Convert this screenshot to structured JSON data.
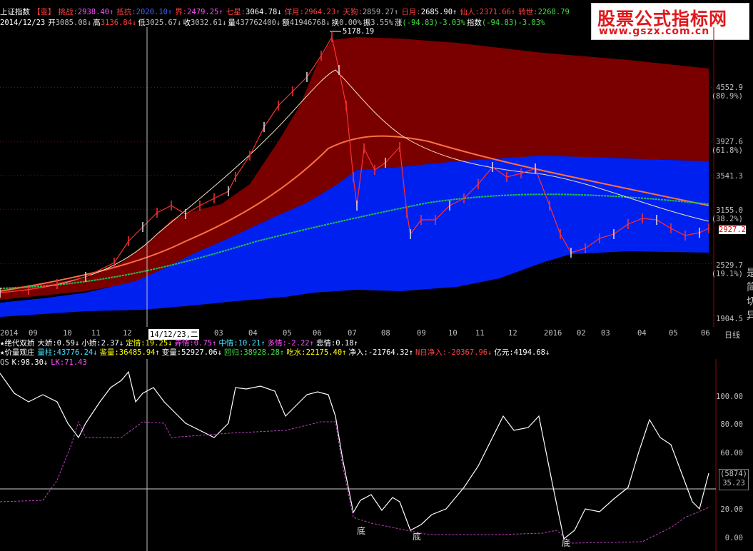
{
  "header_row1": {
    "index_name": "上证指数",
    "mode": "【变】",
    "items": [
      {
        "label": "挑战",
        "value": "2938.40",
        "arrow": "↑",
        "color": "#ff50ff"
      },
      {
        "label": "抵抗",
        "value": "2020.10",
        "arrow": "↑",
        "color": "#4060ff"
      },
      {
        "label": "界",
        "value": "2479.25",
        "arrow": "↑",
        "color": "#ff50ff"
      },
      {
        "label": "七星",
        "value": "3064.78",
        "arrow": "↓",
        "color": "#ffffff"
      },
      {
        "label": "佯月",
        "value": "2964.23",
        "arrow": "↑",
        "color": "#ff4040"
      },
      {
        "label": "天狗",
        "value": "2859.27",
        "arrow": "↑",
        "color": "#b0b0b0"
      },
      {
        "label": "日月",
        "value": "2685.90",
        "arrow": "↑",
        "color": "#ffffff"
      },
      {
        "label": "仙人",
        "value": "2371.66",
        "arrow": "↑",
        "color": "#ff4040"
      },
      {
        "label": "转世",
        "value": "2268.79",
        "arrow": "",
        "color": "#40e040"
      }
    ]
  },
  "header_row2": {
    "date": "2014/12/23",
    "items": [
      {
        "label": "开",
        "value": "3085.08",
        "arrow": "↓",
        "color": "#c0c0c0"
      },
      {
        "label": "高",
        "value": "3136.84",
        "arrow": "↓",
        "color": "#ff4040"
      },
      {
        "label": "低",
        "value": "3025.67",
        "arrow": "↓",
        "color": "#c0c0c0"
      },
      {
        "label": "收",
        "value": "3032.61",
        "arrow": "↓",
        "color": "#c0c0c0"
      },
      {
        "label": "量",
        "value": "437762400",
        "arrow": "↓",
        "color": "#c0c0c0"
      },
      {
        "label": "额",
        "value": "41946768",
        "arrow": "↓",
        "color": "#c0c0c0"
      },
      {
        "label": "换",
        "value": "0.00%",
        "arrow": "",
        "color": "#c0c0c0"
      },
      {
        "label": "振",
        "value": "3.55%",
        "arrow": "",
        "color": "#c0c0c0"
      },
      {
        "label": "涨",
        "value": "(-94.83)-3.03%",
        "arrow": "",
        "color": "#40e040"
      },
      {
        "label": "指数",
        "value": "(-94.83)-3.03%",
        "arrow": "",
        "color": "#40e040"
      }
    ]
  },
  "brand": {
    "title": "股票公式指标网",
    "url": "www.gszx.com.cn"
  },
  "main_chart": {
    "high_annotation": "5178.19",
    "current_price": "2927.2",
    "y_ticks": [
      {
        "label": "4552.9",
        "pct": "(80.9%)"
      },
      {
        "label": "3927.6",
        "pct": "(61.8%)"
      },
      {
        "label": "3541.3",
        "pct": ""
      },
      {
        "label": "3155.0",
        "pct": "(38.2%)"
      },
      {
        "label": "2529.7",
        "pct": "(19.1%)"
      },
      {
        "label": "1904.5",
        "pct": ""
      }
    ]
  },
  "x_axis": {
    "labels": [
      "2014",
      "09",
      "10",
      "11",
      "12",
      "14/12/23,二",
      "03",
      "04",
      "05",
      "06",
      "07",
      "08",
      "09",
      "10",
      "11",
      "12",
      "2016",
      "02",
      "03",
      "04",
      "05",
      "06"
    ],
    "right_label": "日线"
  },
  "indicator_row1": {
    "title": "★绝代双娇",
    "items": [
      {
        "label": "大娇",
        "value": "0.59",
        "arrow": "↓",
        "color": "#ffffff"
      },
      {
        "label": "小娇",
        "value": "2.37",
        "arrow": "↓",
        "color": "#ffffff"
      },
      {
        "label": "定情",
        "value": "19.25",
        "arrow": "↓",
        "color": "#ffff00"
      },
      {
        "label": "弄情",
        "value": "0.75",
        "arrow": "↑",
        "color": "#ff50ff"
      },
      {
        "label": "中情",
        "value": "10.21",
        "arrow": "↑",
        "color": "#40e0ff"
      },
      {
        "label": "多情",
        "value": "-2.22",
        "arrow": "↑",
        "color": "#ff50ff"
      },
      {
        "label": "悲情",
        "value": "0.18",
        "arrow": "↑",
        "color": "#ffffff"
      }
    ]
  },
  "indicator_row2": {
    "title": "★价量观庄",
    "items": [
      {
        "label": "量柱",
        "value": "43776.24",
        "arrow": "↓",
        "color": "#40e0ff"
      },
      {
        "label": "鉴量",
        "value": "36485.94",
        "arrow": "↑",
        "color": "#ffff00"
      },
      {
        "label": "变量",
        "value": "52927.06",
        "arrow": "↓",
        "color": "#ffffff"
      },
      {
        "label": "回归",
        "value": "38928.28",
        "arrow": "↑",
        "color": "#40e040"
      },
      {
        "label": "吃水",
        "value": "22175.40",
        "arrow": "↑",
        "color": "#ffff00"
      },
      {
        "label": "净入",
        "value": "-21764.32",
        "arrow": "↑",
        "color": "#ffffff"
      },
      {
        "label": "N日净入",
        "value": "-20367.96",
        "arrow": "↓",
        "color": "#ff4040"
      },
      {
        "label": "亿元",
        "value": "4194.68",
        "arrow": "↓",
        "color": "#ffffff"
      }
    ]
  },
  "oscillator": {
    "name": "QS",
    "k_label": "K:98.30",
    "k_arrow": "↓",
    "lk_label": "LK:71.43",
    "y_ticks": [
      "100.00",
      "80.00",
      "60.00",
      "20.00",
      "0.00"
    ],
    "box_top": "(5874)",
    "box_bottom": "35.23",
    "bottom_markers": [
      "底",
      "底",
      "底"
    ]
  },
  "right_edge_glyphs": [
    "是",
    "简",
    "切",
    "异"
  ],
  "colors": {
    "upper_band": "#7a0000",
    "lower_band": "#0020f0",
    "price_up": "#ff3030",
    "price_down": "#e0e0e0",
    "ma_orange": "#ff7040",
    "ma_green": "#20c050",
    "grid_dots": "#a00000",
    "oscillator_k": "#ffffff",
    "oscillator_lk": "#c040c0"
  }
}
